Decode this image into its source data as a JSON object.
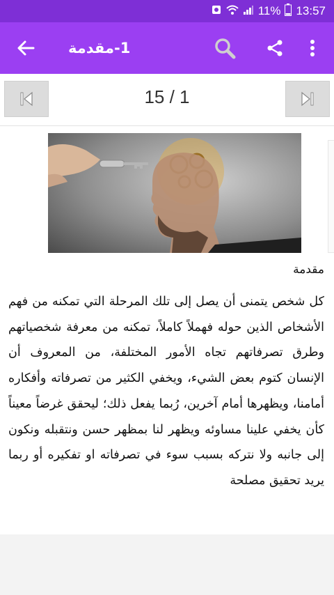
{
  "status": {
    "battery": "11%",
    "time": "13:57"
  },
  "appbar": {
    "title": "1-مقدمة",
    "icons": [
      "back-arrow-icon",
      "search-icon",
      "share-icon",
      "more-vert-icon"
    ]
  },
  "pager": {
    "page_text": "15 / 1",
    "icons": [
      "skip-first-icon",
      "skip-last-icon"
    ]
  },
  "article": {
    "heading": "مقدمة",
    "body": "كل شخص يتمنى أن يصل إلى تلك المرحلة التي تمكنه من فهم الأشخاص الذين حوله فهملاً كاملاً، تمكنه من معرفة شخصياتهم وطرق تصرفاتهم تجاه الأمور المختلفة، من المعروف أن الإنسان كتوم بعض الشيء، ويخفي الكثير من تصرفاته وأفكاره أمامنا، ويظهرها أمام آخرين، رُبما يفعل ذلك؛ ليحقق غرضاً معيناً كأن يخفي علينا مساوئه ويظهر لنا بمظهر حسن ونتقبله ونكون إلى جانبه ولا نتركه بسبب سوء في تصرفاته او تفكيره أو ربما يريد تحقيق مصلحة"
  },
  "colors": {
    "status_bar": "#7e2fd6",
    "app_bar": "#9b3ff2",
    "nav_button": "#dcdcdc"
  }
}
